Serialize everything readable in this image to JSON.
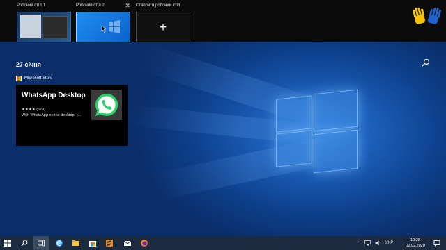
{
  "virtual_desktops": [
    {
      "label": "Робочий стіл 1"
    },
    {
      "label": "Робочий стіл 2",
      "close_glyph": "✕"
    },
    {
      "label": "Створити робочий стіл",
      "plus_glyph": "+"
    }
  ],
  "timeline": {
    "date": "27 січня",
    "source": "Microsoft Store",
    "card": {
      "title": "WhatsApp Desktop",
      "rating": "★★★★ (678)",
      "description": "With WhatsApp on the desktop, y..."
    }
  },
  "taskbar": {
    "language": "УКР",
    "time": "10:28",
    "date": "02.02.2020"
  },
  "colors": {
    "accent": "#1a78e0",
    "whatsapp": "#25d366",
    "taskbar": "#1b2a3e"
  }
}
